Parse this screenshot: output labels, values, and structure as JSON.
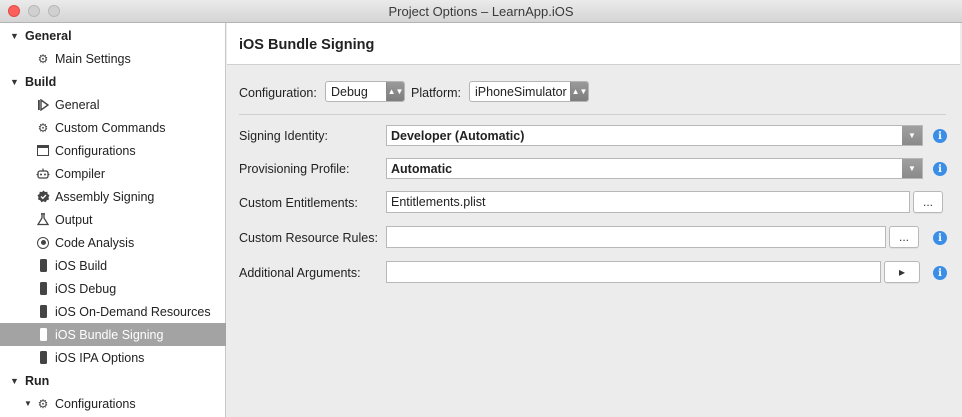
{
  "window": {
    "title": "Project Options – LearnApp.iOS"
  },
  "sidebar": {
    "groups": [
      {
        "label": "General",
        "items": [
          {
            "label": "Main Settings",
            "icon": "gear-icon"
          }
        ]
      },
      {
        "label": "Build",
        "items": [
          {
            "label": "General",
            "icon": "play-bar-icon"
          },
          {
            "label": "Custom Commands",
            "icon": "gear-icon"
          },
          {
            "label": "Configurations",
            "icon": "window-icon"
          },
          {
            "label": "Compiler",
            "icon": "robot-icon"
          },
          {
            "label": "Assembly Signing",
            "icon": "badge-icon"
          },
          {
            "label": "Output",
            "icon": "flask-icon"
          },
          {
            "label": "Code Analysis",
            "icon": "target-icon"
          },
          {
            "label": "iOS Build",
            "icon": "phone-icon"
          },
          {
            "label": "iOS Debug",
            "icon": "phone-icon"
          },
          {
            "label": "iOS On-Demand Resources",
            "icon": "phone-icon"
          },
          {
            "label": "iOS Bundle Signing",
            "icon": "phone-icon",
            "selected": true
          },
          {
            "label": "iOS IPA Options",
            "icon": "phone-icon"
          }
        ]
      },
      {
        "label": "Run",
        "items": [
          {
            "label": "Configurations",
            "icon": "gear-icon"
          }
        ]
      }
    ]
  },
  "main": {
    "title": "iOS Bundle Signing",
    "configuration_label": "Configuration:",
    "configuration_value": "Debug",
    "platform_label": "Platform:",
    "platform_value": "iPhoneSimulator",
    "signing_identity_label": "Signing Identity:",
    "signing_identity_value": "Developer (Automatic)",
    "provisioning_profile_label": "Provisioning Profile:",
    "provisioning_profile_value": "Automatic",
    "custom_entitlements_label": "Custom Entitlements:",
    "custom_entitlements_value": "Entitlements.plist",
    "custom_resource_rules_label": "Custom Resource Rules:",
    "custom_resource_rules_value": "",
    "additional_arguments_label": "Additional Arguments:",
    "additional_arguments_value": "",
    "browse_label": "...",
    "info_glyph": "i",
    "play_glyph": "▸"
  }
}
